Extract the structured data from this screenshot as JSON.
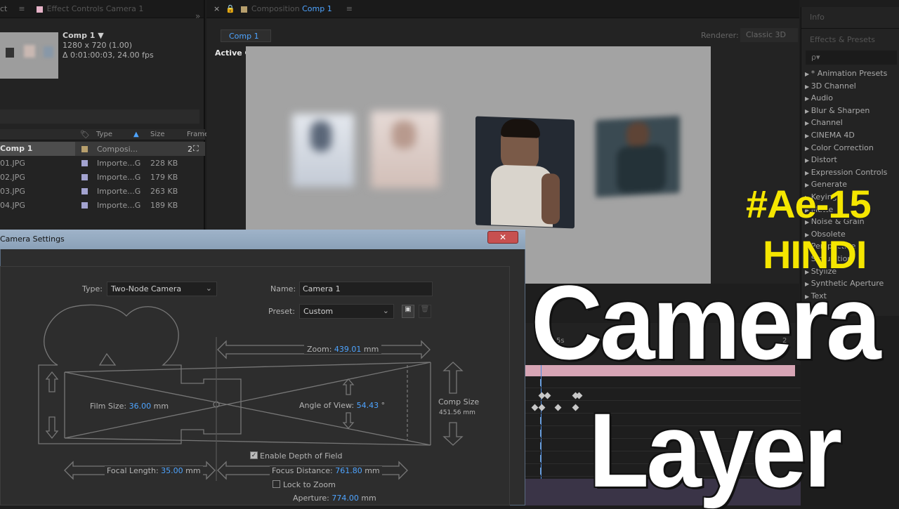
{
  "project_panel": {
    "tab_fragment": "ct",
    "tab_effect_controls": "Effect Controls Camera 1",
    "comp_name": "Comp 1 ▼",
    "comp_res": "1280 x 720 (1.00)",
    "comp_dur": "Δ 0:01:00:03, 24.00 fps",
    "columns": {
      "type": "Type",
      "size": "Size",
      "frame": "Frame"
    },
    "rows": [
      {
        "name": "Comp 1",
        "type": "Composi...",
        "size": "",
        "color": "#b79f6d",
        "selected": true
      },
      {
        "name": "01.JPG",
        "type": "Importe...G",
        "size": "228 KB",
        "color": "#a3a3d0",
        "selected": false
      },
      {
        "name": "02.JPG",
        "type": "Importe...G",
        "size": "179 KB",
        "color": "#a3a3d0",
        "selected": false
      },
      {
        "name": "03.JPG",
        "type": "Importe...G",
        "size": "263 KB",
        "color": "#a3a3d0",
        "selected": false
      },
      {
        "name": "04.JPG",
        "type": "Importe...G",
        "size": "189 KB",
        "color": "#a3a3d0",
        "selected": false
      }
    ]
  },
  "comp_panel": {
    "tab_label": "Composition",
    "tab_comp": "Comp 1",
    "subtab": "Comp 1",
    "renderer_label": "Renderer:",
    "renderer_value": "Classic 3D",
    "view_label": "Active Camera"
  },
  "right_panel": {
    "info": "Info",
    "effects_presets": "Effects & Presets",
    "search_placeholder": "ρ▾",
    "effects": [
      "* Animation Presets",
      "3D Channel",
      "Audio",
      "Blur & Sharpen",
      "Channel",
      "CINEMA 4D",
      "Color Correction",
      "Distort",
      "Expression Controls",
      "Generate",
      "Keying",
      "Matte",
      "Noise & Grain",
      "Obsolete",
      "Perspective",
      "Simulation",
      "Stylize",
      "Synthetic Aperture",
      "Text"
    ]
  },
  "timeline": {
    "ruler_label": "5s",
    "ruler_label2": "2"
  },
  "dialog": {
    "title": "Camera Settings",
    "type_label": "Type:",
    "type_value": "Two-Node Camera",
    "name_label": "Name:",
    "name_value": "Camera 1",
    "preset_label": "Preset:",
    "preset_value": "Custom",
    "zoom_label": "Zoom:",
    "zoom_value": "439.01",
    "zoom_unit": "mm",
    "film_size_label": "Film Size:",
    "film_size_value": "36.00",
    "film_size_unit": "mm",
    "angle_label": "Angle of View:",
    "angle_value": "54.43",
    "angle_unit": "°",
    "comp_size_label": "Comp Size",
    "comp_size_value": "451.56 mm",
    "dof_label": "Enable Depth of Field",
    "focal_label": "Focal Length:",
    "focal_value": "35.00",
    "focal_unit": "mm",
    "focus_label": "Focus Distance:",
    "focus_value": "761.80",
    "focus_unit": "mm",
    "lock_label": "Lock to Zoom",
    "aperture_label": "Aperture:",
    "aperture_value": "774.00",
    "aperture_unit": "mm"
  },
  "overlay": {
    "tag": "#Ae-15",
    "lang": "HINDI",
    "title1": "Camera",
    "title2": "Layer",
    "tag_color": "#f5e600",
    "title_color": "#ffffff"
  }
}
